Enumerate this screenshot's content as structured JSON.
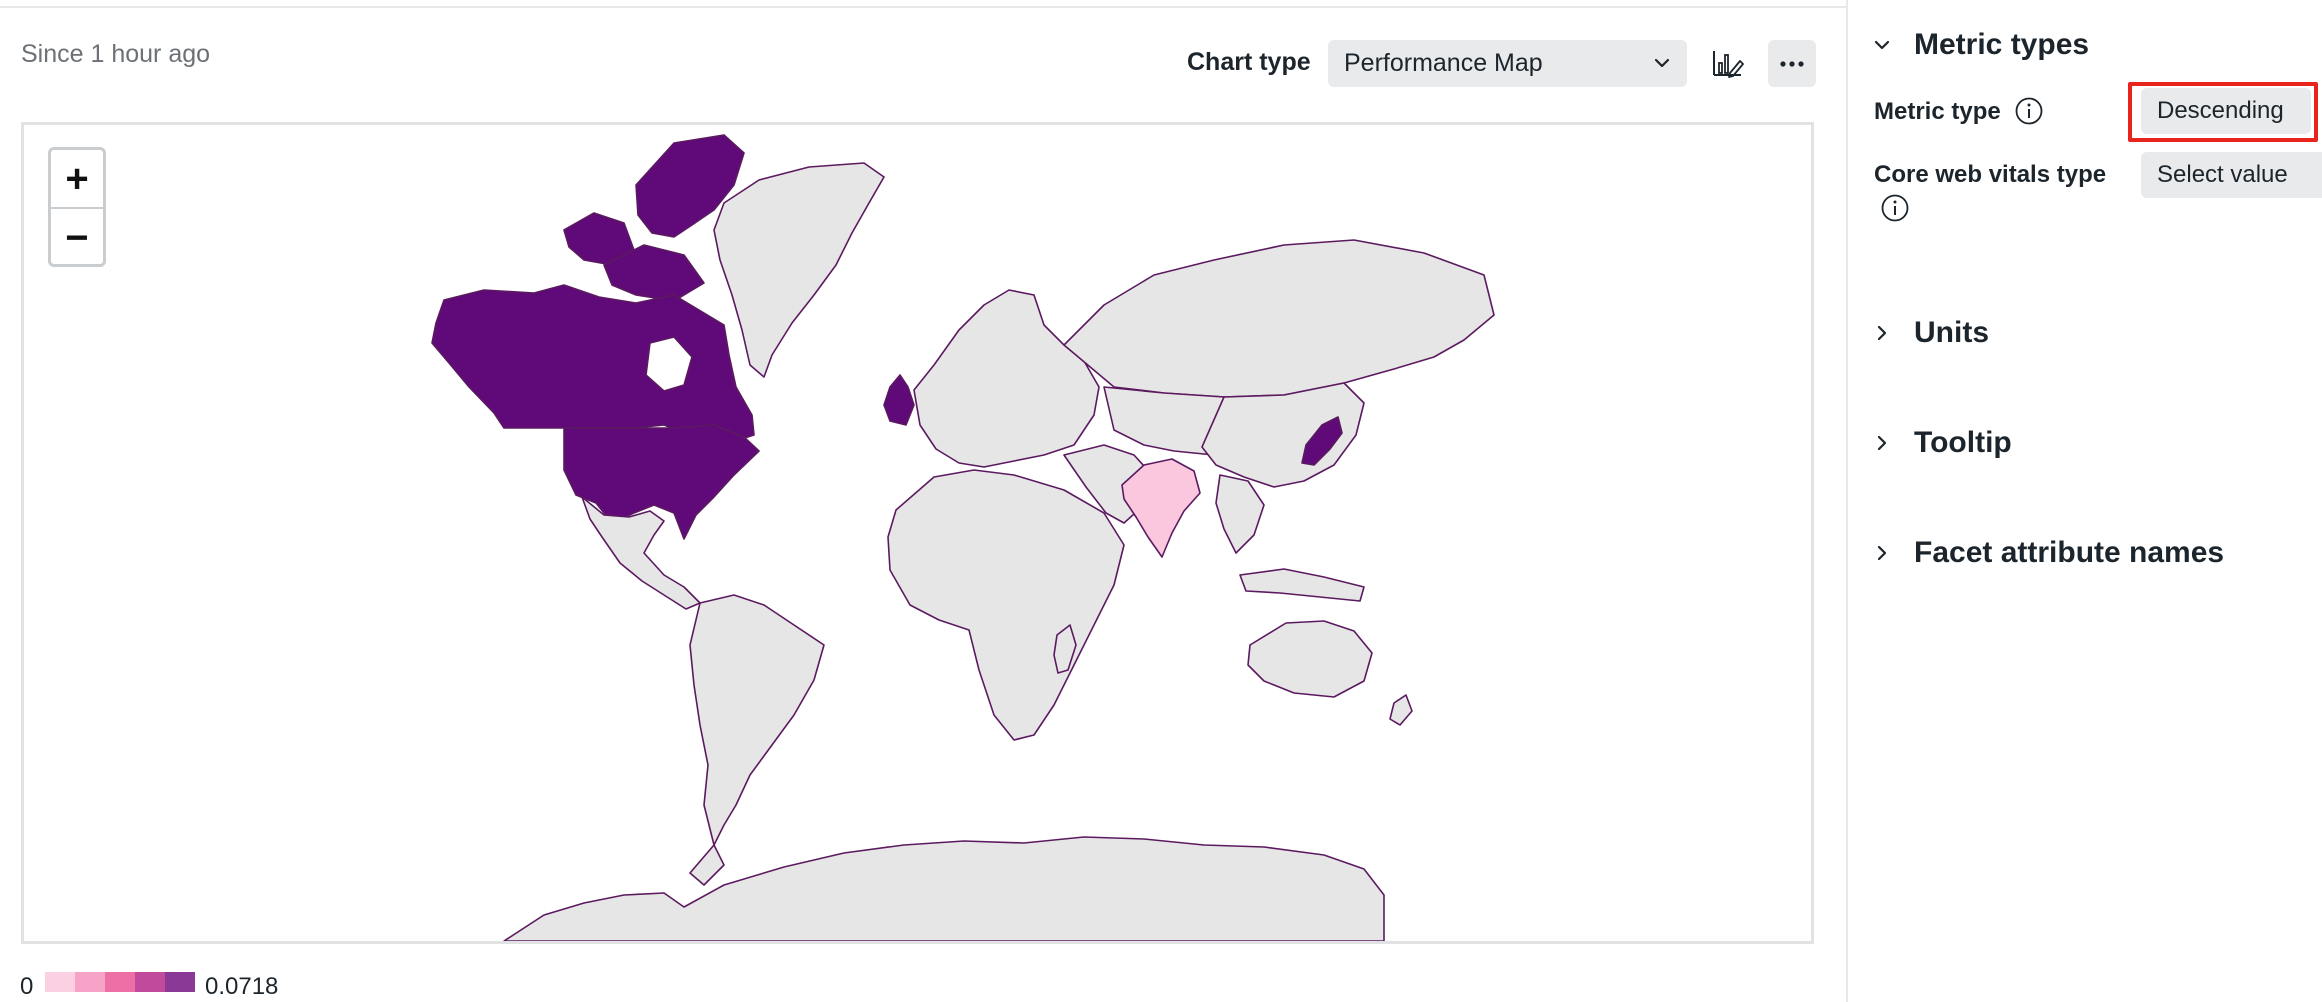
{
  "header": {
    "time_range": "Since 1 hour ago"
  },
  "toolbar": {
    "chart_type_label": "Chart type",
    "chart_type_value": "Performance Map",
    "chart_settings_icon": "chart-edit-icon",
    "more_icon": "ellipsis-icon"
  },
  "map": {
    "zoom_in_label": "+",
    "zoom_out_label": "−",
    "colors": {
      "highest": "#5f0a78",
      "low": "#fbc7de",
      "no_data": "#e6e6e6",
      "border": "#5b1a60"
    }
  },
  "legend": {
    "min_label": "0",
    "max_label": "0.0718",
    "swatches": [
      "#fbd0e2",
      "#f7a3c8",
      "#ee6ea6",
      "#c24a9d",
      "#8a3a96"
    ]
  },
  "panel": {
    "metric_types": {
      "title": "Metric types",
      "expanded": true,
      "metric_type_label": "Metric type",
      "metric_type_value": "Descending",
      "core_web_vitals_label": "Core web vitals type",
      "core_web_vitals_value": "Select value"
    },
    "units": {
      "title": "Units",
      "expanded": false
    },
    "tooltip": {
      "title": "Tooltip",
      "expanded": false
    },
    "facet_attribute_names": {
      "title": "Facet attribute names",
      "expanded": false
    }
  },
  "highlight": {
    "color": "#e8251c",
    "target": "Metric type value"
  }
}
